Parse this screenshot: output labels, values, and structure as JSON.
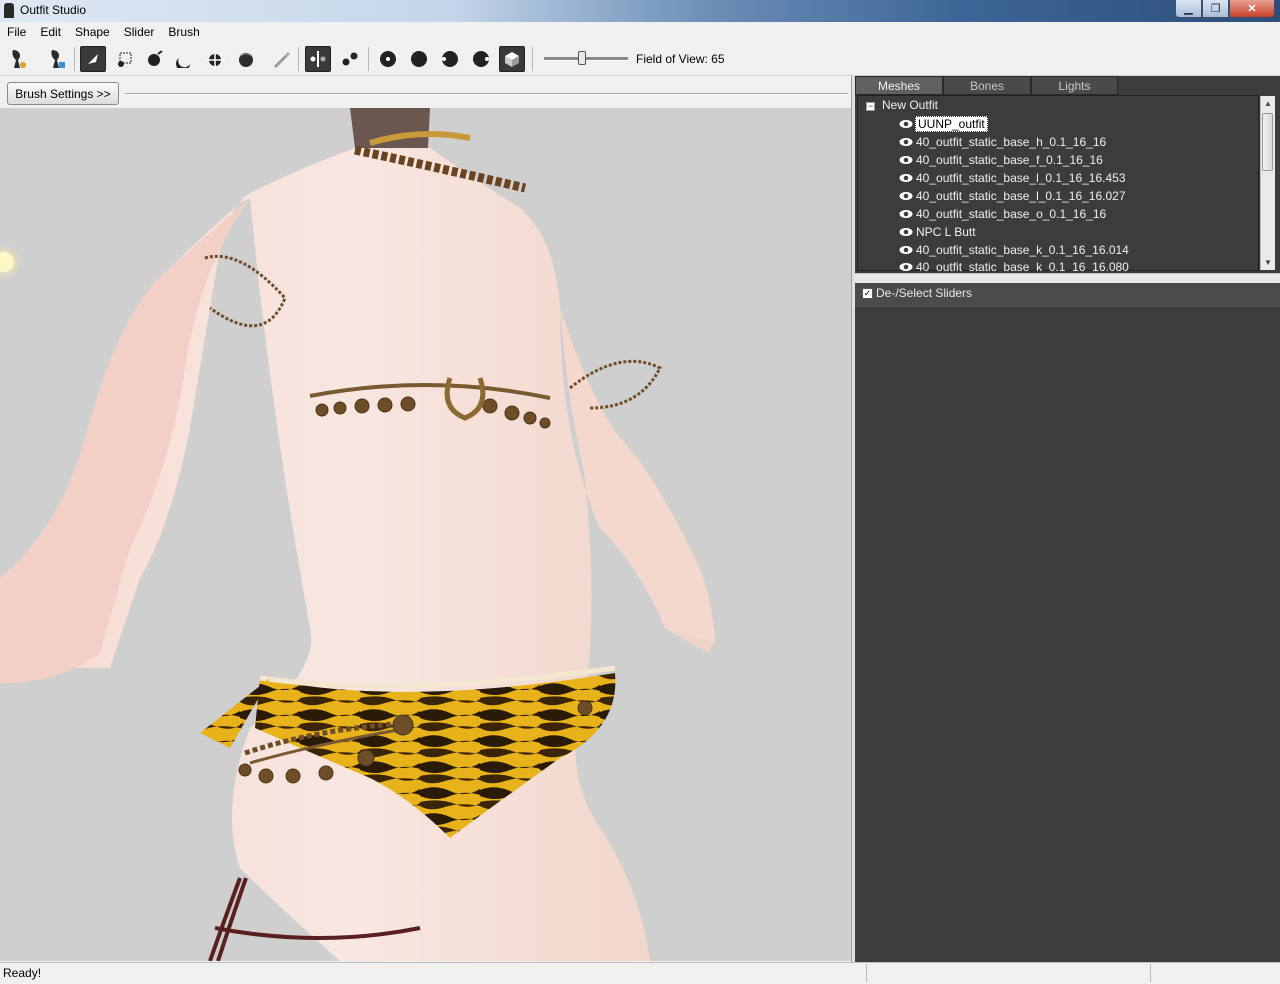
{
  "window": {
    "title": "Outfit Studio",
    "minimize_icon": "▁",
    "maximize_icon": "❐",
    "close_icon": "✕"
  },
  "menu": [
    "File",
    "Edit",
    "Shape",
    "Slider",
    "Brush"
  ],
  "toolbar": {
    "icons": [
      "load-reference-icon",
      "load-outfit-icon",
      "select-brush-icon",
      "mask-brush-icon",
      "inflate-brush-icon",
      "deflate-brush-icon",
      "move-brush-icon",
      "smooth-brush-icon",
      "weight-brush-icon",
      "x-mirror-icon",
      "connected-only-icon",
      "front-view-icon",
      "back-view-icon",
      "left-view-icon",
      "right-view-icon",
      "perspective-icon"
    ],
    "field_of_view_label": "Field of View: 65",
    "field_of_view": 65
  },
  "brush_settings_label": "Brush Settings >>",
  "panel": {
    "tabs": [
      "Meshes",
      "Bones",
      "Lights"
    ],
    "active_tab": "Meshes",
    "tree": {
      "root": "New Outfit",
      "items": [
        "UUNP_outfit",
        "40_outfit_static_base_h_0.1_16_16",
        "40_outfit_static_base_f_0.1_16_16",
        "40_outfit_static_base_l_0.1_16_16.453",
        "40_outfit_static_base_l_0.1_16_16.027",
        "40_outfit_static_base_o_0.1_16_16",
        "NPC L Butt",
        "40_outfit_static_base_k_0.1_16_16.014",
        "40_outfit_static_base_k_0.1_16_16.080"
      ],
      "selected": "UUNP_outfit"
    },
    "sliders_checkbox_label": "De-/Select Sliders",
    "sliders_checked": true
  },
  "status": {
    "text": "Ready!"
  },
  "colors": {
    "viewport_bg": "#cfcfcf",
    "panel_bg": "#3c3c3c",
    "skin": "#f2d6cc",
    "tiger_yellow": "#e8b21a"
  }
}
